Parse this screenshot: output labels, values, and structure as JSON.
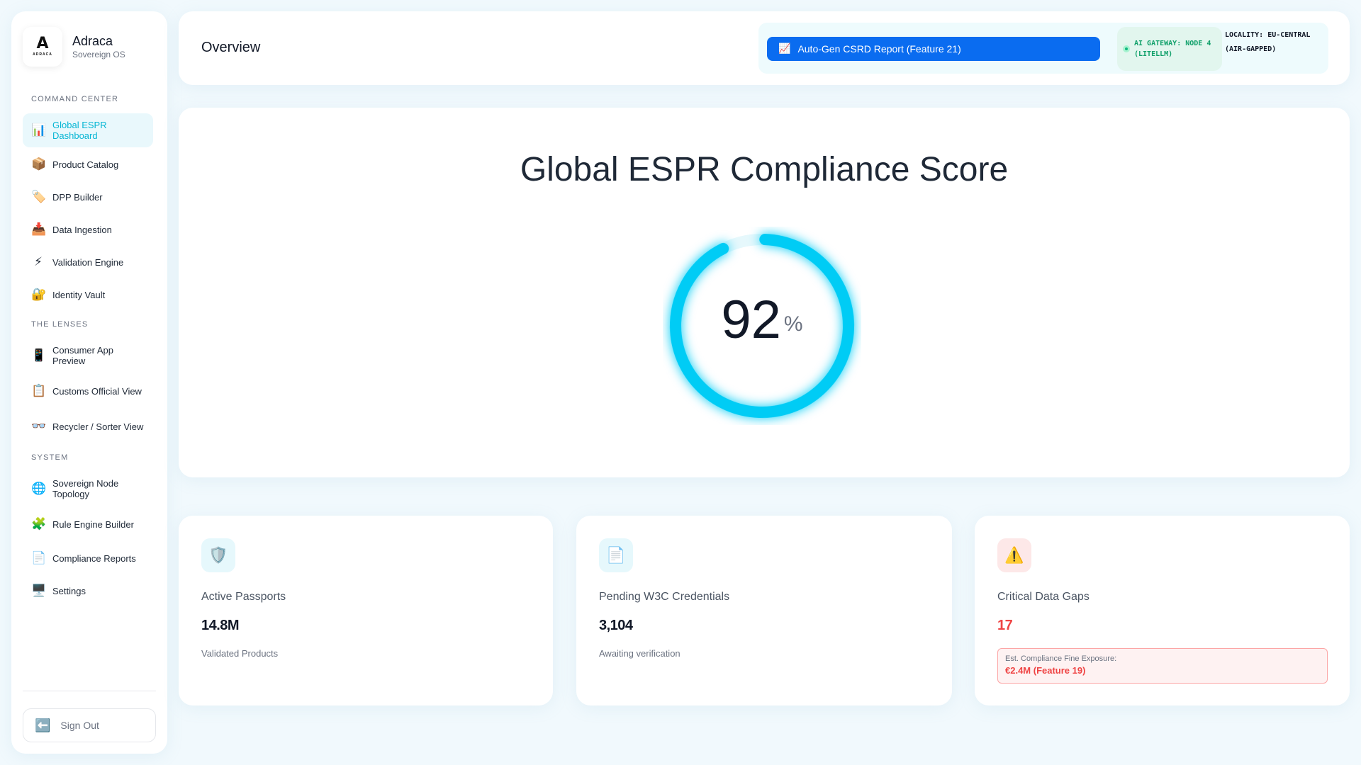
{
  "brand": {
    "name": "Adraca",
    "subtitle": "Sovereign OS",
    "logo_mark": "A",
    "logo_word": "ADRACA"
  },
  "sidebar": {
    "sections": [
      {
        "label": "COMMAND CENTER",
        "items": [
          {
            "label": "Global ESPR Dashboard",
            "icon": "📊",
            "icon_name": "bar-chart-icon",
            "active": true
          },
          {
            "label": "Product Catalog",
            "icon": "📦",
            "icon_name": "package-icon"
          },
          {
            "label": "DPP Builder",
            "icon": "🏷️",
            "icon_name": "tag-icon"
          },
          {
            "label": "Data Ingestion",
            "icon": "📥",
            "icon_name": "inbox-icon"
          },
          {
            "label": "Validation Engine",
            "icon": "⚡",
            "icon_name": "lightning-icon"
          },
          {
            "label": "Identity Vault",
            "icon": "🔐",
            "icon_name": "lock-key-icon"
          }
        ]
      },
      {
        "label": "THE LENSES",
        "items": [
          {
            "label": "Consumer App Preview",
            "icon": "📱",
            "icon_name": "phone-icon"
          },
          {
            "label": "Customs Official View",
            "icon": "📋",
            "icon_name": "clipboard-icon"
          },
          {
            "label": "Recycler / Sorter View",
            "icon": "👓",
            "icon_name": "glasses-icon"
          }
        ]
      },
      {
        "label": "SYSTEM",
        "items": [
          {
            "label": "Sovereign Node Topology",
            "icon": "🌐",
            "icon_name": "globe-icon"
          },
          {
            "label": "Rule Engine Builder",
            "icon": "🧩",
            "icon_name": "puzzle-icon"
          },
          {
            "label": "Compliance Reports",
            "icon": "📄",
            "icon_name": "document-icon"
          },
          {
            "label": "Settings",
            "icon": "🖥️",
            "icon_name": "monitor-icon"
          }
        ]
      }
    ],
    "signout": {
      "label": "Sign Out",
      "icon": "⬅️",
      "icon_name": "arrow-left-icon"
    }
  },
  "header": {
    "title": "Overview",
    "csrd_button": {
      "label": "Auto-Gen CSRD Report (Feature 21)",
      "icon": "📈",
      "icon_name": "trend-chart-icon"
    },
    "gateway_status": "AI GATEWAY: NODE 4 (LITELLM)",
    "locality": "LOCALITY: EU-CENTRAL (AIR-GAPPED)"
  },
  "score": {
    "title": "Global ESPR Compliance Score",
    "value": "92",
    "unit": "%",
    "fraction": 0.92,
    "color": "#00ccf5",
    "track_color": "#e6f8fc"
  },
  "stats": [
    {
      "icon": "🛡️",
      "icon_name": "shield-icon",
      "icon_bg": "#e6f8fc",
      "label": "Active Passports",
      "value": "14.8M",
      "sub": "Validated Products"
    },
    {
      "icon": "📄",
      "icon_name": "document-icon",
      "icon_bg": "#e6f8fc",
      "label": "Pending W3C Credentials",
      "value": "3,104",
      "sub": "Awaiting verification"
    },
    {
      "icon": "⚠️",
      "icon_name": "warning-icon",
      "icon_bg": "#fde8e8",
      "label": "Critical Data Gaps",
      "value": "17",
      "fine_label": "Est. Compliance Fine Exposure:",
      "fine_value": "€2.4M (Feature 19)"
    }
  ]
}
